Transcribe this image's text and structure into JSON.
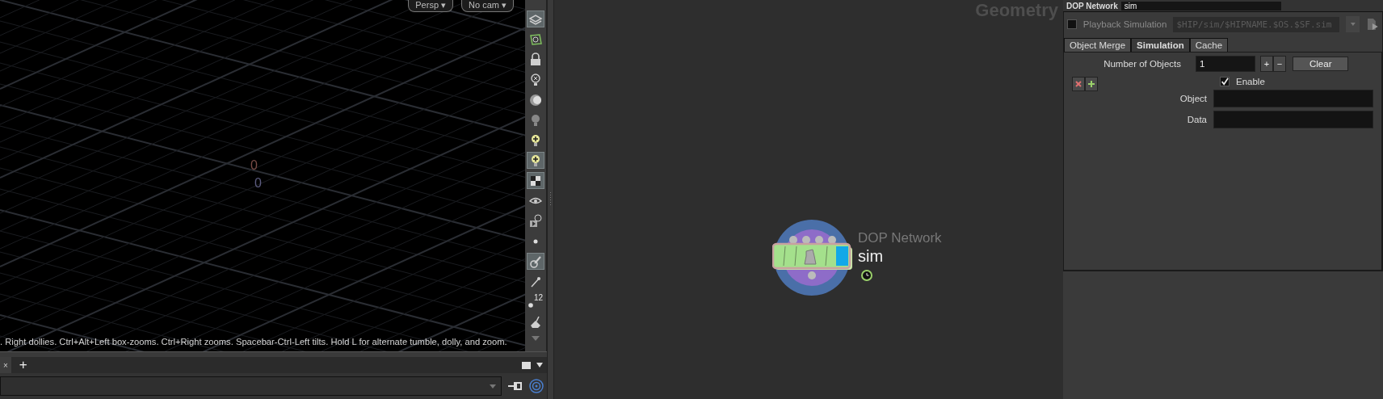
{
  "viewport": {
    "camera_buttons": [
      {
        "label": "Persp ▾"
      },
      {
        "label": "No cam ▾"
      }
    ],
    "origin_labels": [
      {
        "text": "0",
        "color": "#7a4c46"
      },
      {
        "text": "0",
        "color": "#5c5c80"
      }
    ],
    "hint": ". Right dollies. Ctrl+Alt+Left box-zooms. Ctrl+Right zooms. Spacebar-Ctrl-Left tilts. Hold L for alternate tumble, dolly, and zoom."
  },
  "toolbar": [
    {
      "selected": true
    },
    {
      "selected": false
    },
    {
      "selected": false
    },
    {
      "selected": false
    },
    {
      "selected": false
    },
    {
      "selected": false
    },
    {
      "selected": false
    },
    {
      "selected": true
    },
    {
      "selected": true
    },
    {
      "selected": false
    },
    {
      "selected": false
    },
    {
      "selected": false
    },
    {
      "selected": true
    },
    {
      "selected": false
    },
    {
      "selected": false,
      "label": "12"
    },
    {
      "selected": false
    }
  ],
  "pane_tabs": {
    "close": "×",
    "add": "+"
  },
  "network": {
    "title": "Geometry",
    "node": {
      "type_label": "DOP Network",
      "name": "sim"
    }
  },
  "parameters": {
    "header": {
      "type": "DOP Network",
      "name": "sim"
    },
    "playback": {
      "label": "Playback Simulation",
      "checked": false,
      "file": "$HIP/sim/$HIPNAME.$OS.$SF.sim"
    },
    "tabs": [
      {
        "label": "Object Merge",
        "selected": false
      },
      {
        "label": "Simulation",
        "selected": true
      },
      {
        "label": "Cache",
        "selected": false
      }
    ],
    "count": {
      "label": "Number of Objects",
      "value": "1",
      "add": "+",
      "remove": "−",
      "clear": "Clear"
    },
    "instance": {
      "enable": {
        "label": "Enable",
        "checked": true
      },
      "fields": [
        {
          "label": "Object"
        },
        {
          "label": "Data"
        }
      ]
    }
  }
}
